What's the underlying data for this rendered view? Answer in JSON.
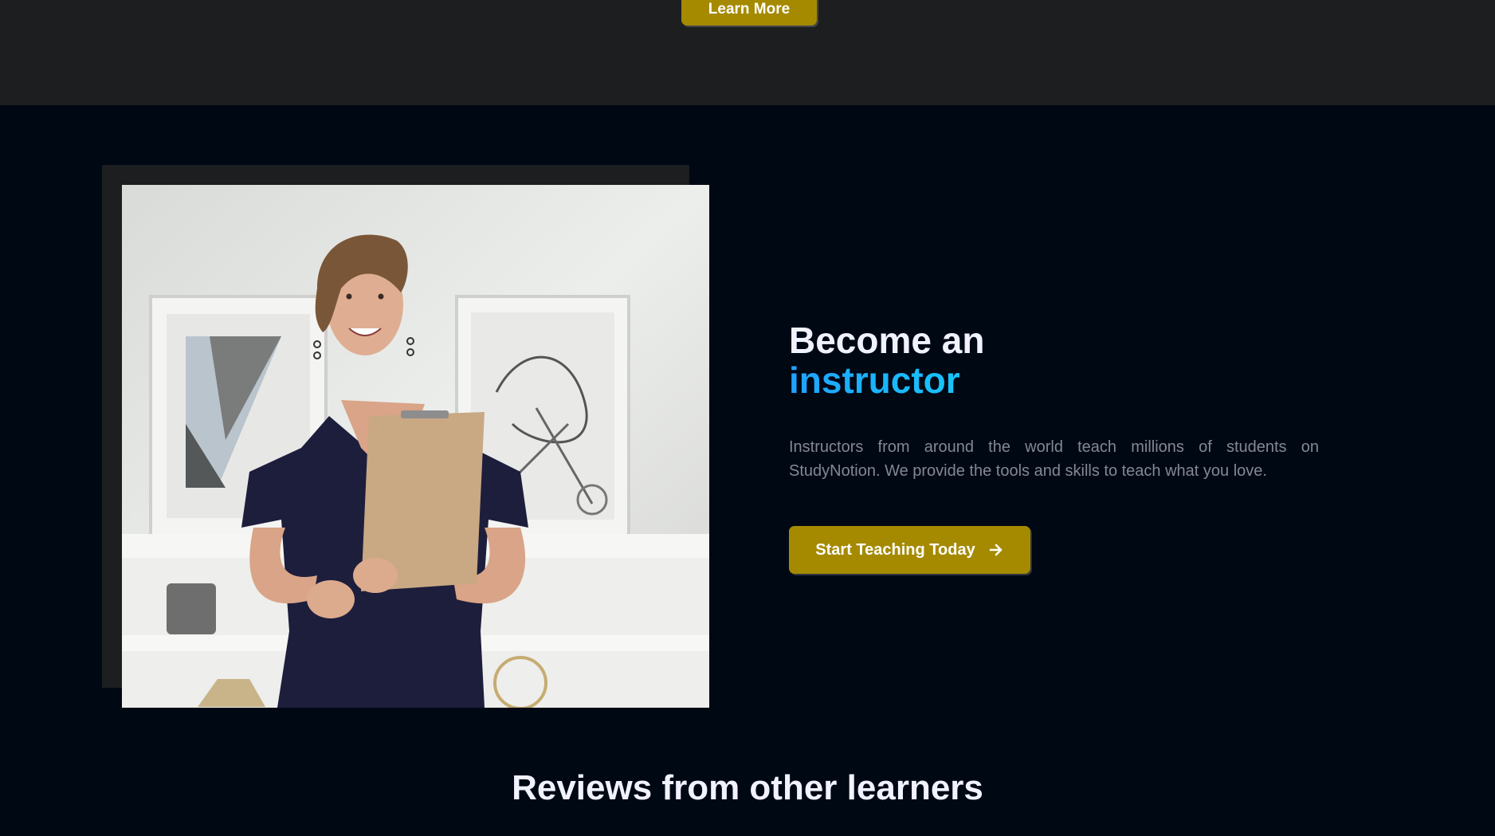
{
  "top_section": {
    "learn_more_label": "Learn More"
  },
  "instructor_section": {
    "heading_line1": "Become an",
    "heading_accent": "instructor",
    "description": "Instructors from around the world teach millions of students on StudyNotion. We provide the tools and skills to teach what you love.",
    "cta_label": "Start Teaching Today",
    "cta_icon": "arrow-right-icon",
    "image_alt": "smiling instructor holding a clipboard"
  },
  "reviews": {
    "title": "Reviews from other learners"
  },
  "colors": {
    "background": "#000814",
    "top_band": "#1c1e20",
    "button_yellow": "#a58a00",
    "heading_text": "#f1f2ff",
    "accent_cyan": "#12d8fa",
    "body_text": "#838894"
  }
}
